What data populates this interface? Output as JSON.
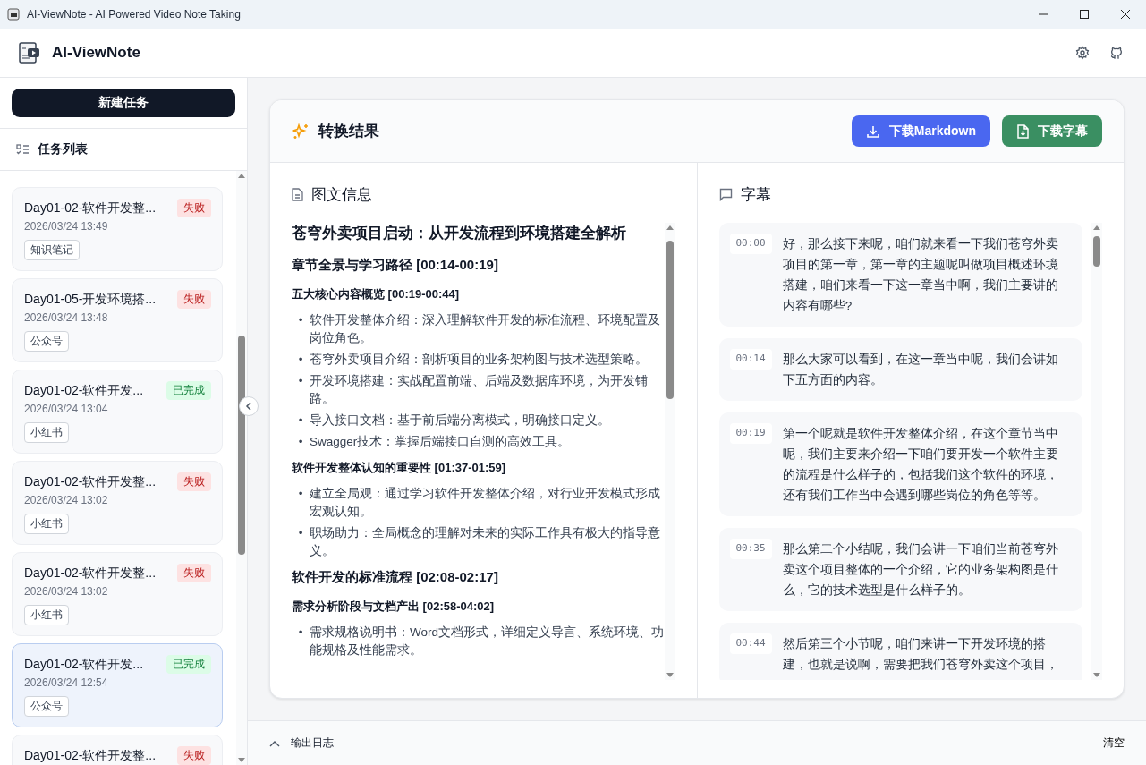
{
  "window": {
    "title": "AI-ViewNote - AI Powered Video Note Taking"
  },
  "app": {
    "name": "AI-ViewNote"
  },
  "sidebar": {
    "new_task_button": "新建任务",
    "list_title": "任务列表",
    "tasks": [
      {
        "title": "Day01-02-软件开发整...",
        "time": "2026/03/24 13:49",
        "tag": "知识笔记",
        "status": {
          "label": "失败",
          "kind": "failed"
        },
        "selected": false
      },
      {
        "title": "Day01-05-开发环境搭...",
        "time": "2026/03/24 13:48",
        "tag": "公众号",
        "status": {
          "label": "失败",
          "kind": "failed"
        },
        "selected": false
      },
      {
        "title": "Day01-02-软件开发...",
        "time": "2026/03/24 13:04",
        "tag": "小红书",
        "status": {
          "label": "已完成",
          "kind": "done"
        },
        "selected": false
      },
      {
        "title": "Day01-02-软件开发整...",
        "time": "2026/03/24 13:02",
        "tag": "小红书",
        "status": {
          "label": "失败",
          "kind": "failed"
        },
        "selected": false
      },
      {
        "title": "Day01-02-软件开发整...",
        "time": "2026/03/24 13:02",
        "tag": "小红书",
        "status": {
          "label": "失败",
          "kind": "failed"
        },
        "selected": false
      },
      {
        "title": "Day01-02-软件开发...",
        "time": "2026/03/24 12:54",
        "tag": "公众号",
        "status": {
          "label": "已完成",
          "kind": "done"
        },
        "selected": true
      },
      {
        "title": "Day01-02-软件开发整...",
        "status": {
          "label": "失败",
          "kind": "failed"
        },
        "selected": false
      }
    ]
  },
  "result": {
    "title": "转换结果",
    "buttons": [
      {
        "label": "下载Markdown",
        "kind": "markdown"
      },
      {
        "label": "下载字幕",
        "kind": "subtitle"
      }
    ],
    "notes": {
      "title": "图文信息",
      "blocks": [
        {
          "kind": "title",
          "text": "苍穹外卖项目启动：从开发流程到环境搭建全解析"
        },
        {
          "kind": "h2",
          "text": "章节全景与学习路径 [00:14-00:19]"
        },
        {
          "kind": "h3",
          "text": "五大核心内容概览 [00:19-00:44]"
        },
        {
          "kind": "bullet",
          "marker": "•",
          "text": "软件开发整体介绍：深入理解软件开发的标准流程、环境配置及岗位角色。"
        },
        {
          "kind": "bullet",
          "marker": "•",
          "text": "苍穹外卖项目介绍：剖析项目的业务架构图与技术选型策略。"
        },
        {
          "kind": "bullet",
          "marker": "•",
          "text": "开发环境搭建：实战配置前端、后端及数据库环境，为开发铺路。"
        },
        {
          "kind": "bullet",
          "marker": "•",
          "text": "导入接口文档：基于前后端分离模式，明确接口定义。"
        },
        {
          "kind": "bullet",
          "marker": "•",
          "text": "Swagger技术：掌握后端接口自测的高效工具。"
        },
        {
          "kind": "h3",
          "text": "软件开发整体认知的重要性 [01:37-01:59]"
        },
        {
          "kind": "bullet",
          "marker": "•",
          "text": "建立全局观：通过学习软件开发整体介绍，对行业开发模式形成宏观认知。"
        },
        {
          "kind": "bullet",
          "marker": "•",
          "text": "职场助力：全局概念的理解对未来的实际工作具有极大的指导意义。"
        },
        {
          "kind": "h2",
          "text": "软件开发的标准流程 [02:08-02:17]"
        },
        {
          "kind": "h3",
          "text": "需求分析阶段与文档产出 [02:58-04:02]"
        },
        {
          "kind": "bullet",
          "marker": "•",
          "text": "需求规格说明书：Word文档形式，详细定义导言、系统环境、功能规格及性能需求。"
        }
      ]
    },
    "subtitles": {
      "title": "字幕",
      "items": [
        {
          "time": "00:00",
          "text": "好，那么接下来呢，咱们就来看一下我们苍穹外卖项目的第一章，第一章的主题呢叫做项目概述环境搭建，咱们来看一下这一章当中啊，我们主要讲的内容有哪些?"
        },
        {
          "time": "00:14",
          "text": "那么大家可以看到，在这一章当中呢，我们会讲如下五方面的内容。"
        },
        {
          "time": "00:19",
          "text": "第一个呢就是软件开发整体介绍，在这个章节当中呢，我们主要来介绍一下咱们要开发一个软件主要的流程是什么样子的，包括我们这个软件的环境，还有我们工作当中会遇到哪些岗位的角色等等。"
        },
        {
          "time": "00:35",
          "text": "那么第二个小结呢，我们会讲一下咱们当前苍穹外卖这个项目整体的一个介绍，它的业务架构图是什么，它的技术选型是什么样子的。"
        },
        {
          "time": "00:44",
          "text": "然后第三个小节呢，咱们来讲一下开发环境的搭建，也就是说啊，需要把我们苍穹外卖这个项目，"
        }
      ]
    }
  },
  "log_panel": {
    "title": "输出日志",
    "clear_button": "清空",
    "expanded": false
  }
}
